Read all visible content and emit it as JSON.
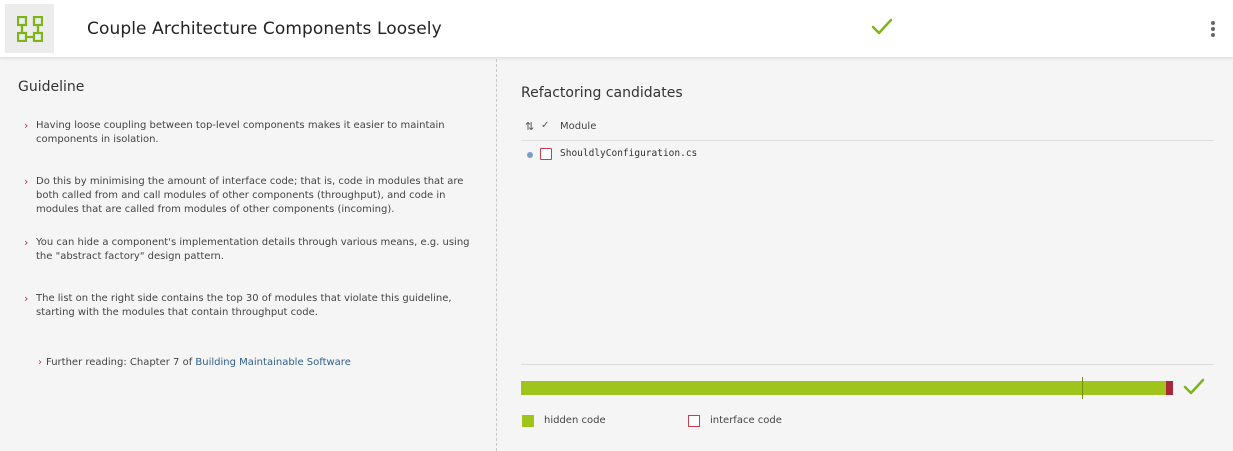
{
  "header": {
    "title": "Couple Architecture Components Loosely",
    "icon": "component-diagram-icon",
    "status_icon": "check-icon",
    "menu_icon": "kebab-menu-icon",
    "accent_color": "#7cb518"
  },
  "guideline": {
    "heading": "Guideline",
    "items": [
      "Having loose coupling between top-level components makes it easier to maintain components in isolation.",
      "Do this by minimising the amount of interface code; that is, code in modules that are both called from and call modules of other components (throughput), and code in modules that are called from modules of other components (incoming).",
      "You can hide a component's implementation details through various means, e.g. using the \"abstract factory\" design pattern.",
      "The list on the right side contains the top 30 of modules that violate this guideline, starting with the modules that contain throughput code."
    ],
    "further_reading_prefix": "Further reading: Chapter 7 of ",
    "further_reading_link": "Building Maintainable Software"
  },
  "refactoring": {
    "heading": "Refactoring candidates",
    "columns": {
      "module": "Module"
    },
    "rows": [
      {
        "module": "ShouldlyConfiguration.cs"
      }
    ]
  },
  "summary": {
    "hidden_fraction": 0.99,
    "marker_fraction": 0.86,
    "hidden_color": "#9fc41c",
    "interface_color": "#a8283a",
    "legend": {
      "hidden": "hidden code",
      "interface": "interface code"
    }
  }
}
